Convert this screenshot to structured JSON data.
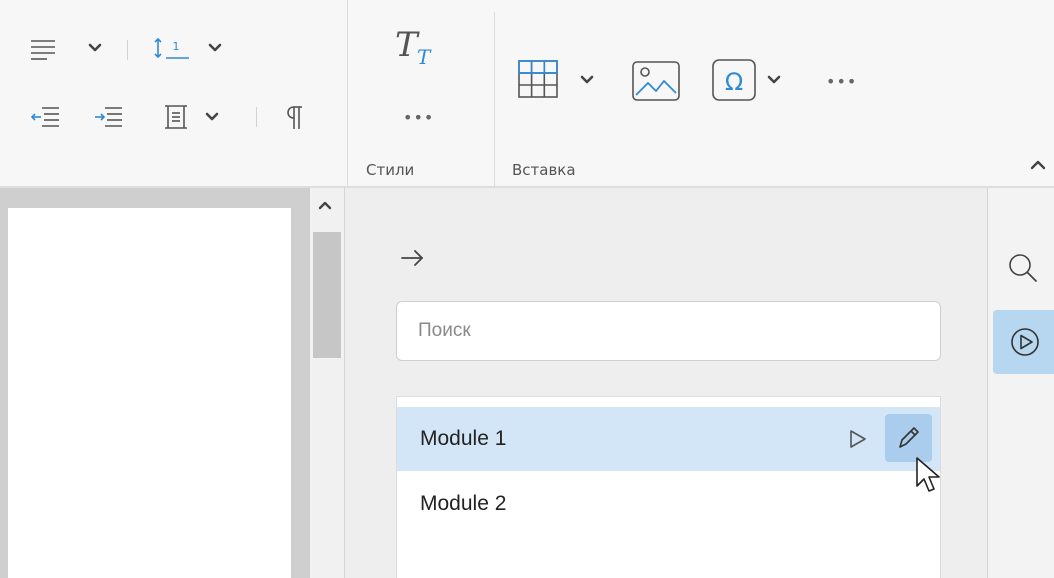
{
  "ribbon": {
    "styles_group_label": "Стили",
    "insert_group_label": "Вставка",
    "more_dots": "•••"
  },
  "panel": {
    "search": {
      "placeholder": "Поиск",
      "value": ""
    },
    "modules": [
      {
        "label": "Module 1",
        "selected": true
      },
      {
        "label": "Module 2",
        "selected": false
      }
    ]
  },
  "colors": {
    "accent_blue": "#2f8ad6",
    "selection_bg": "#d3e6f7",
    "hover_button_bg": "#aacdee",
    "rail_active_bg": "#b7d6ef"
  }
}
